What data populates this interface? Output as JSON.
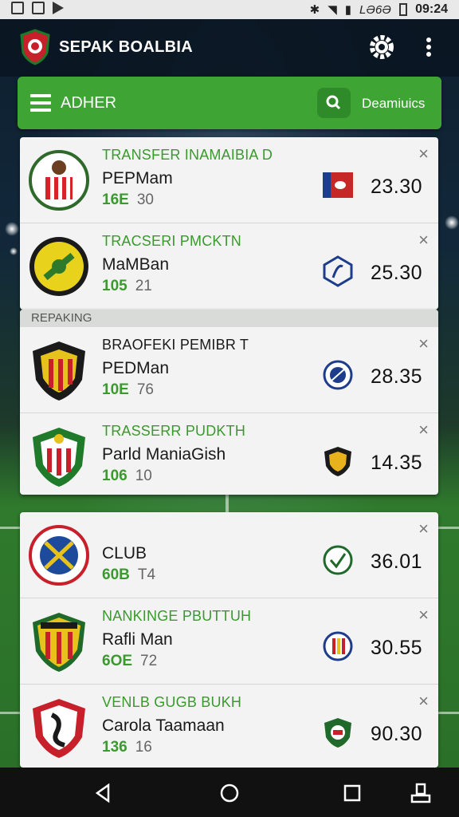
{
  "status_bar": {
    "carrier": "LƏ6Ə",
    "time": "09:24"
  },
  "app": {
    "title": "SEPAK BOALBIA"
  },
  "toolbar": {
    "label": "ADHER",
    "link": "Deamiuics"
  },
  "section": {
    "label": "REPAKING"
  },
  "cards": [
    {
      "rows": [
        {
          "headline": "TRANSFER INAMAIBIA D",
          "player": "PEPMam",
          "code": "16E",
          "num": "30",
          "price": "23.30"
        },
        {
          "headline": "TRACSERI PMCKTN",
          "player": "MaMBan",
          "code": "105",
          "num": "21",
          "price": "25.30"
        }
      ]
    },
    {
      "rows": [
        {
          "headline": "BRAOFEKI PEMIBR T",
          "player": "PEDMan",
          "code": "10E",
          "num": "76",
          "price": "28.35"
        },
        {
          "headline": "TRASSERR PUDKTH",
          "player": "Parld ManiaGish",
          "code": "106",
          "num": "10",
          "price": "14.35"
        }
      ]
    },
    {
      "rows": [
        {
          "headline": "",
          "player": "CLUB",
          "code": "60B",
          "num": "T4",
          "price": "36.01"
        },
        {
          "headline": "NANKINGE PBUTTUH",
          "player": "Rafli Man",
          "code": "6OE",
          "num": "72",
          "price": "30.55"
        },
        {
          "headline": "VENLB GUGB BUKH",
          "player": "Carola Taamaan",
          "code": "136",
          "num": "16",
          "price": "90.30"
        }
      ]
    }
  ],
  "colors": {
    "accent": "#3ea535",
    "appbar": "#0a1622",
    "card": "#f2f3f2"
  },
  "icons": [
    "menu-icon",
    "search-icon",
    "gear-icon",
    "more-icon",
    "close-icon",
    "back-icon",
    "home-icon",
    "recents-icon"
  ]
}
